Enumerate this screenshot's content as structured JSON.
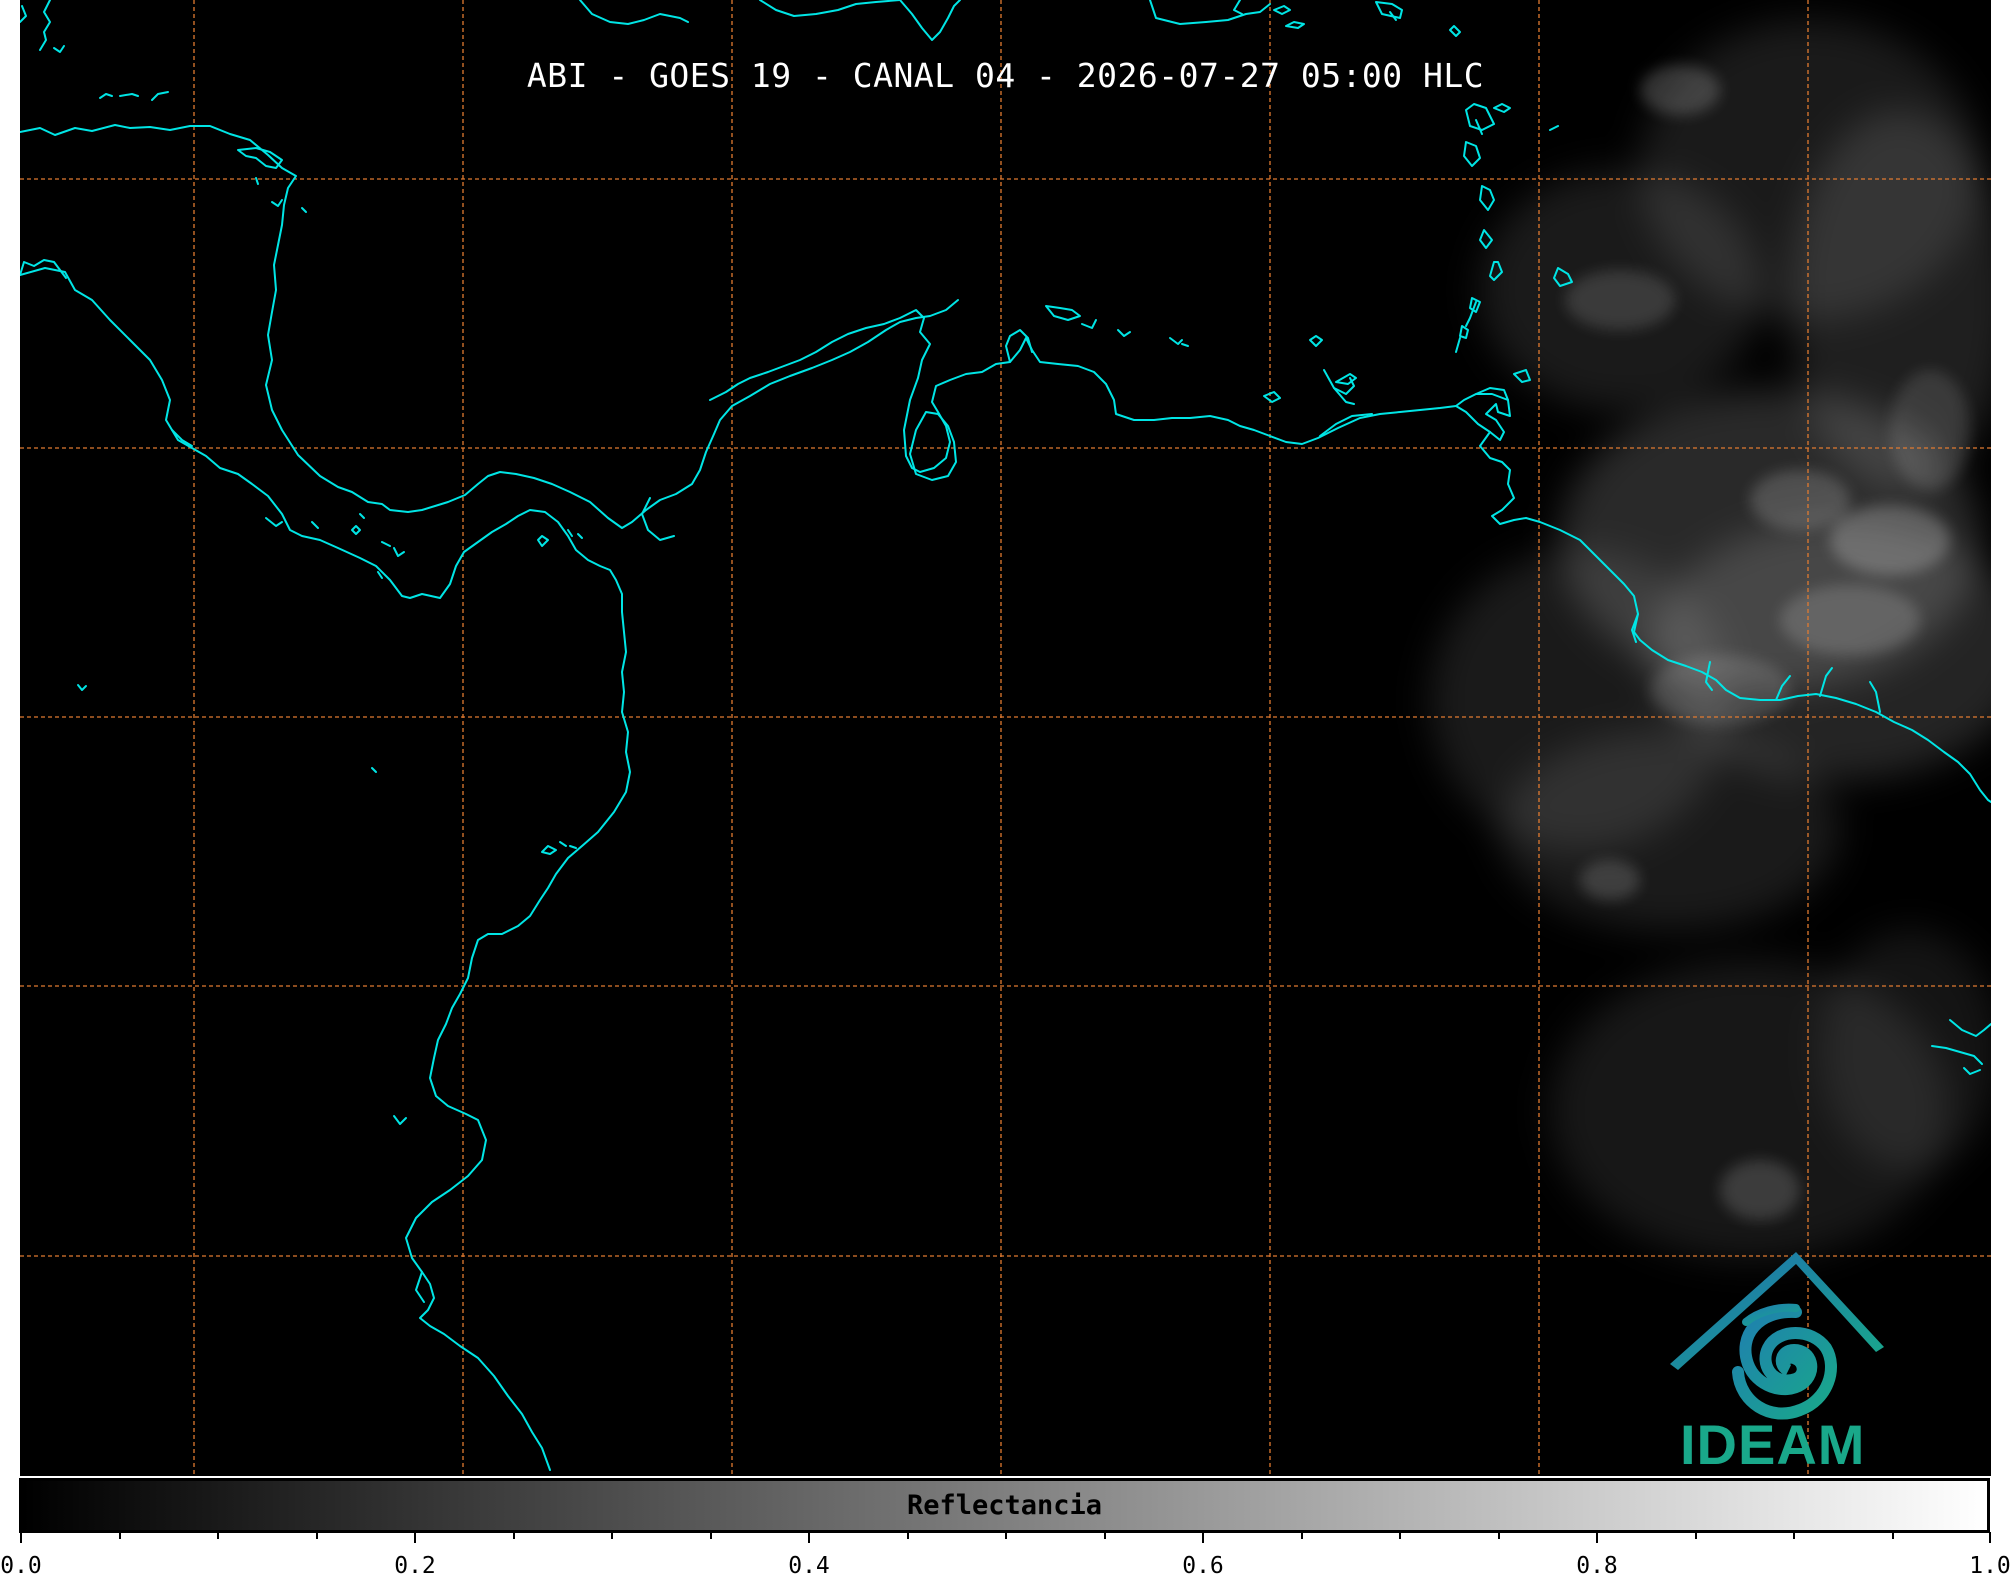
{
  "map": {
    "title": "ABI - GOES 19 - CANAL 04 - 2026-07-27 05:00 HLC",
    "coastline_color": "#00e5e5",
    "grid_color": "#e07a30",
    "background_color": "#000000"
  },
  "colorbar": {
    "label": "Reflectancia",
    "range": [
      0.0,
      1.0
    ],
    "ticks": [
      "0.0",
      "0.2",
      "0.4",
      "0.6",
      "0.8",
      "1.0"
    ],
    "cmap_start": "#000000",
    "cmap_end": "#ffffff"
  },
  "logo": {
    "text": "IDEAM",
    "color": "#19a88a"
  }
}
